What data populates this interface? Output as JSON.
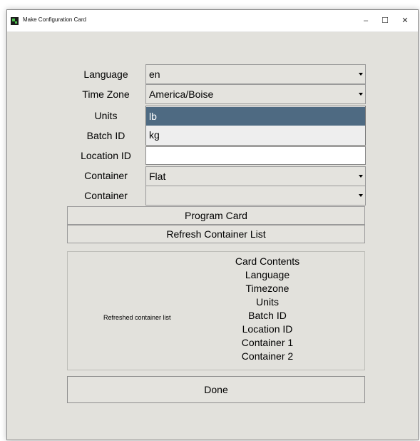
{
  "window": {
    "title": "Make Configuration Card",
    "minimize_glyph": "–",
    "maximize_glyph": "☐",
    "close_glyph": "✕"
  },
  "form": {
    "language": {
      "label": "Language",
      "value": "en"
    },
    "timezone": {
      "label": "Time Zone",
      "value": "America/Boise"
    },
    "units": {
      "label": "Units",
      "options": [
        "lb",
        "kg"
      ],
      "selected": "lb"
    },
    "batch_id": {
      "label": "Batch ID"
    },
    "location_id": {
      "label": "Location ID",
      "value": ""
    },
    "container1": {
      "label": "Container",
      "value": "Flat"
    },
    "container2": {
      "label": "Container",
      "value": ""
    }
  },
  "buttons": {
    "program_card": "Program Card",
    "refresh_container_list": "Refresh Container List",
    "done": "Done"
  },
  "status_text": "Refreshed container list",
  "card_contents": {
    "heading": "Card Contents",
    "items": [
      "Language",
      "Timezone",
      "Units",
      "Batch ID",
      "Location ID",
      "Container 1",
      "Container 2"
    ]
  },
  "icons": {
    "app_icon": "app-icon",
    "dropdown_arrow": "chevron-down-icon"
  }
}
